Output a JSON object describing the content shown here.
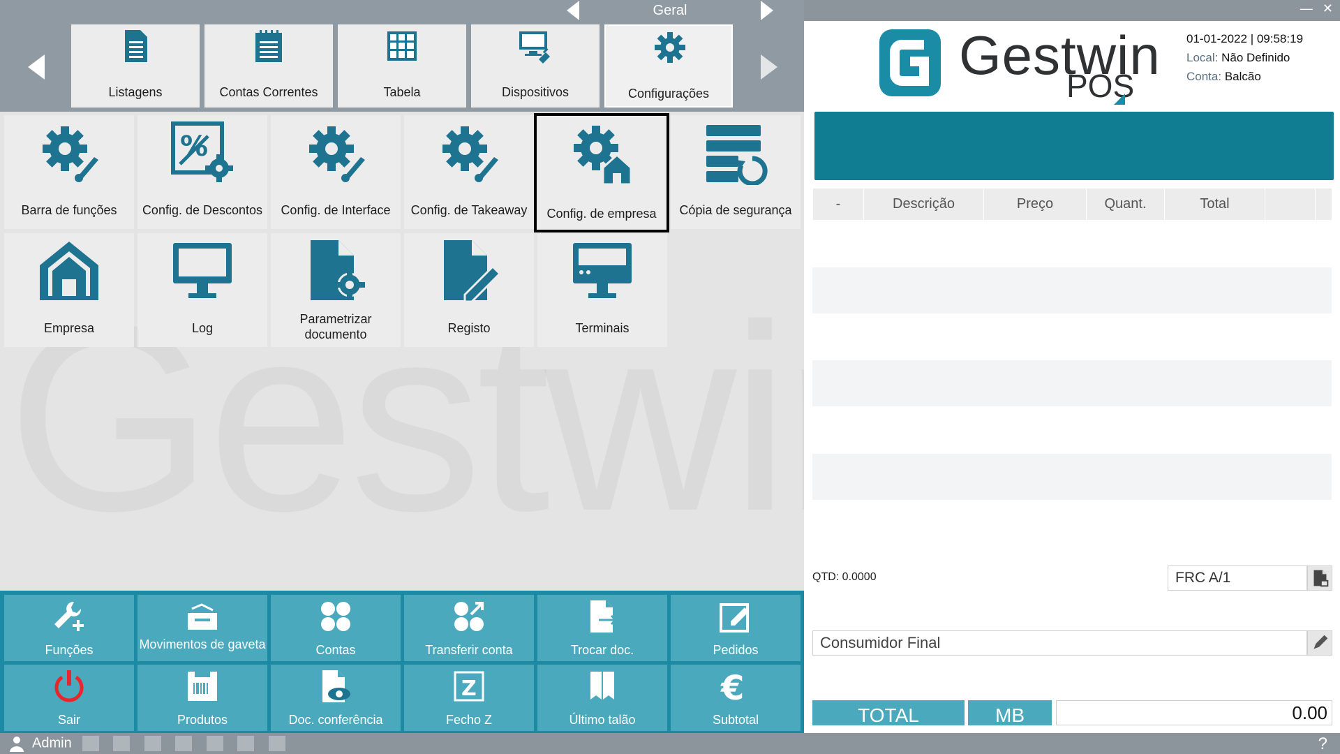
{
  "header": {
    "category_title": "Geral",
    "tabs": [
      {
        "label": "Listagens",
        "icon": "list-document-icon"
      },
      {
        "label": "Contas Correntes",
        "icon": "notepad-icon"
      },
      {
        "label": "Tabela",
        "icon": "grid-table-icon"
      },
      {
        "label": "Dispositivos",
        "icon": "monitor-plug-icon"
      },
      {
        "label": "Configurações",
        "icon": "gear-icon",
        "active": true
      }
    ]
  },
  "functions": {
    "row1": [
      {
        "label": "Barra de funções",
        "icon": "gear-brush-icon"
      },
      {
        "label": "Config. de Descontos",
        "icon": "percent-gear-icon"
      },
      {
        "label": "Config. de Interface",
        "icon": "gear-brush-icon"
      },
      {
        "label": "Config. de Takeaway",
        "icon": "gear-brush-icon"
      },
      {
        "label": "Config. de empresa",
        "icon": "gear-house-icon",
        "selected": true
      },
      {
        "label": "Cópia de segurança",
        "icon": "database-restore-icon"
      }
    ],
    "row2": [
      {
        "label": "Empresa",
        "icon": "house-icon"
      },
      {
        "label": "Log",
        "icon": "monitor-icon"
      },
      {
        "label": "Parametrizar documento",
        "icon": "document-gear-icon"
      },
      {
        "label": "Registo",
        "icon": "document-pen-icon"
      },
      {
        "label": "Terminais",
        "icon": "terminal-monitor-icon"
      }
    ]
  },
  "watermark": "Gestwin",
  "actions": {
    "row1": [
      {
        "label": "Funções",
        "icon": "wrench-plus-icon"
      },
      {
        "label": "Movimentos de gaveta",
        "icon": "cash-drawer-icon"
      },
      {
        "label": "Contas",
        "icon": "four-dots-icon"
      },
      {
        "label": "Transferir conta",
        "icon": "transfer-dots-icon"
      },
      {
        "label": "Trocar doc.",
        "icon": "document-swap-icon"
      },
      {
        "label": "Pedidos",
        "icon": "edit-square-icon"
      }
    ],
    "row2": [
      {
        "label": "Sair",
        "icon": "power-icon"
      },
      {
        "label": "Produtos",
        "icon": "barcode-box-icon"
      },
      {
        "label": "Doc. conferência",
        "icon": "document-eye-icon"
      },
      {
        "label": "Fecho Z",
        "icon": "z-box-icon"
      },
      {
        "label": "Último talão",
        "icon": "receipt-icon"
      },
      {
        "label": "Subtotal",
        "icon": "euro-icon"
      }
    ]
  },
  "status": {
    "user": "Admin",
    "help": "?"
  },
  "brand": {
    "name": "Gestwin",
    "product": "POS",
    "accent": "#1a8ca6",
    "panel_teal": "#1b8aa2",
    "button_teal": "#4aa9bd"
  },
  "info": {
    "date": "01-01-2022",
    "time": "09:58:19",
    "local_label": "Local:",
    "local_value": "Não Definido",
    "conta_label": "Conta:",
    "conta_value": "Balcão"
  },
  "ticket": {
    "columns": [
      "-",
      "Descrição",
      "Preço",
      "Quant.",
      "Total"
    ]
  },
  "footer": {
    "qtd": "QTD: 0.0000",
    "document": "FRC A/1",
    "customer": "Consumidor Final",
    "total_label": "TOTAL",
    "payment_label": "MB",
    "total_value": "0.00"
  }
}
